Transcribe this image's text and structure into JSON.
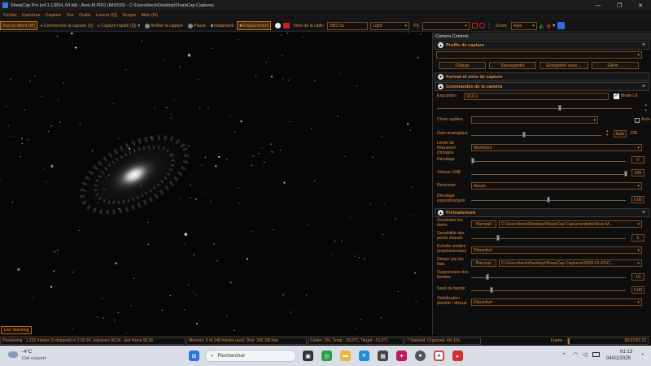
{
  "window": {
    "title": "SharpCap Pro (v4.1.12834, 64 bit) - Ares-M PRO (IMX533) - C:\\Users\\beck\\Desktop\\SharpCap Captures",
    "minimize": "—",
    "maximize": "❐",
    "close": "✕"
  },
  "menu": [
    "Fichier",
    "Caméras",
    "Capture",
    "Vue",
    "Outils",
    "Lancer (Q)",
    "Scripts",
    "Aide (H)"
  ],
  "toolbar": {
    "live_view": "Vue en direct (W)",
    "start_capture": "Commencer la capture (S)",
    "quick_capture": "Capture rapide (Q)",
    "stop_capture": "Arrêter la capture",
    "pause": "Pause",
    "snapshot": "Instantané",
    "placement": "Emplacement",
    "target_label": "Nom de la cible:",
    "target_value": "M81 ha",
    "frame_type": "Light",
    "fx_label": "FX",
    "zoom_label": "Zoom:",
    "zoom_value": "Auto"
  },
  "live_stacking": "Live Stacking",
  "panel": {
    "title": "Camera Controls",
    "profiles": {
      "heading": "Profils de capture",
      "buttons": [
        "Charge",
        "Sauvegarder",
        "Enregistrer sous ...",
        "Gérer ..."
      ]
    },
    "format_heading": "Format et zone de capture",
    "camera_controls": {
      "heading": "Commandes de la caméra",
      "exposure_label": "Exposition",
      "exposure_value": "90,0 s",
      "lx_mode_label": "Mode LX",
      "lx_mode_checked": true,
      "quick_choices_label": "Choix rapides",
      "auto_label": "Auto",
      "analog_gain_label": "Gain analogique",
      "analog_gain_auto": "Auto",
      "analog_gain_value": "238",
      "frame_rate_limit_label": "Limite de fréquence d'images",
      "frame_rate_limit_value": "Maximum",
      "offset_label": "Décalage",
      "offset_value": "0",
      "usb_speed_label": "Vitesse USB",
      "usb_speed_value": "100",
      "flip_label": "Retourner",
      "flip_value": "Aucun",
      "exposure_gain_offset_label": "Décalage exposition/gain",
      "exposure_gain_offset_value": "0,00"
    },
    "preprocessing": {
      "heading": "Prétraitement",
      "subtract_darks_label": "Soustraire les darks",
      "browse_label": "Parcouri",
      "darks_path": "C:\\Users\\beck\\Desktop\\SharpCap Captures\\darks\\Ares-M...",
      "hot_pixel_label": "Sensibilité des pixels chauds",
      "hot_pixel_value": "5",
      "dark_scale_label": "Échelle sombre (expérimentale)",
      "dark_scale_value": "Désactivé",
      "divide_flats_label": "Diviser par les flats",
      "flats_path": "C:\\Users\\beck\\Desktop\\SharpCap Captures\\2025-01-01\\C...",
      "banding_suppression_label": "Suppression des bandes",
      "banding_suppression_value": "10",
      "banding_threshold_label": "Seuil de bande",
      "banding_threshold_value": "5,00",
      "stabilisation_label": "Stabilisation planète / disque",
      "stabilisation_value": "Désactivé"
    }
  },
  "status": {
    "previewing": "Previewing : 1,225 frames (0 dropped) in 2:20:24, exposure 90,0s , last frame 90,0s",
    "memory": "Memory: 5 of 148 frames used, Disk: 245 GB free",
    "cooler": "Cooler: 2%, Temp: -15,0°C, Target: -15,0°C",
    "stacked": "7 Stacked, 0 Ignored, 4m 10s",
    "frame_label": "Frame :",
    "frame_progress": 0.02,
    "frame_time": "00:07/01:23"
  },
  "taskbar": {
    "weather_temp": "-4°C",
    "weather_desc": "Ciel couvert",
    "search_placeholder": "Rechercher",
    "time": "01:13",
    "date": "04/01/2025"
  },
  "colors": {
    "accent": "#e08a3c",
    "border": "#7a4a1e",
    "active": "#c66a1c"
  }
}
